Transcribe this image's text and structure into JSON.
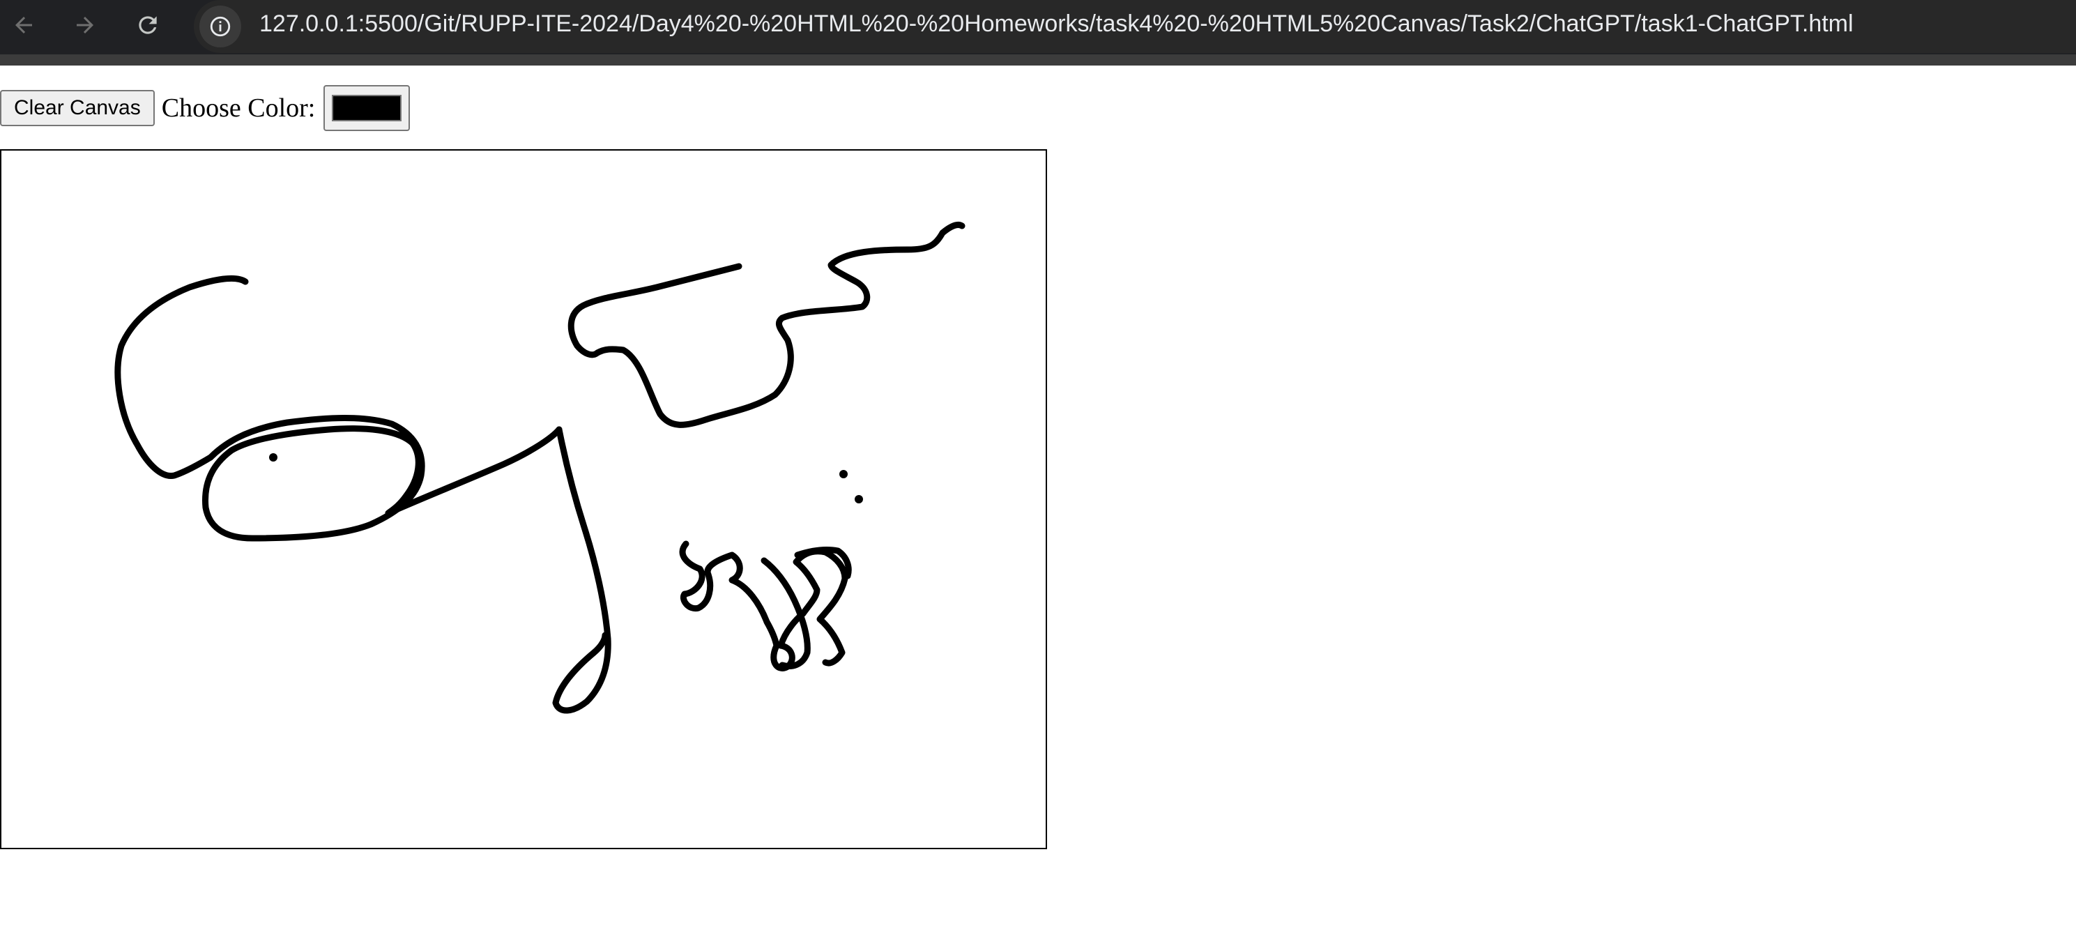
{
  "browser": {
    "url": "127.0.0.1:5500/Git/RUPP-ITE-2024/Day4%20-%20HTML%20-%20Homeworks/task4%20-%20HTML5%20Canvas/Task2/ChatGPT/task1-ChatGPT.html",
    "icons": [
      "back-icon",
      "forward-icon",
      "reload-icon",
      "site-info-icon"
    ]
  },
  "toolbar": {
    "clear_label": "Clear Canvas",
    "color_label": "Choose Color:",
    "color_value": "#000000"
  },
  "canvas": {
    "stroke_color": "#000000"
  }
}
